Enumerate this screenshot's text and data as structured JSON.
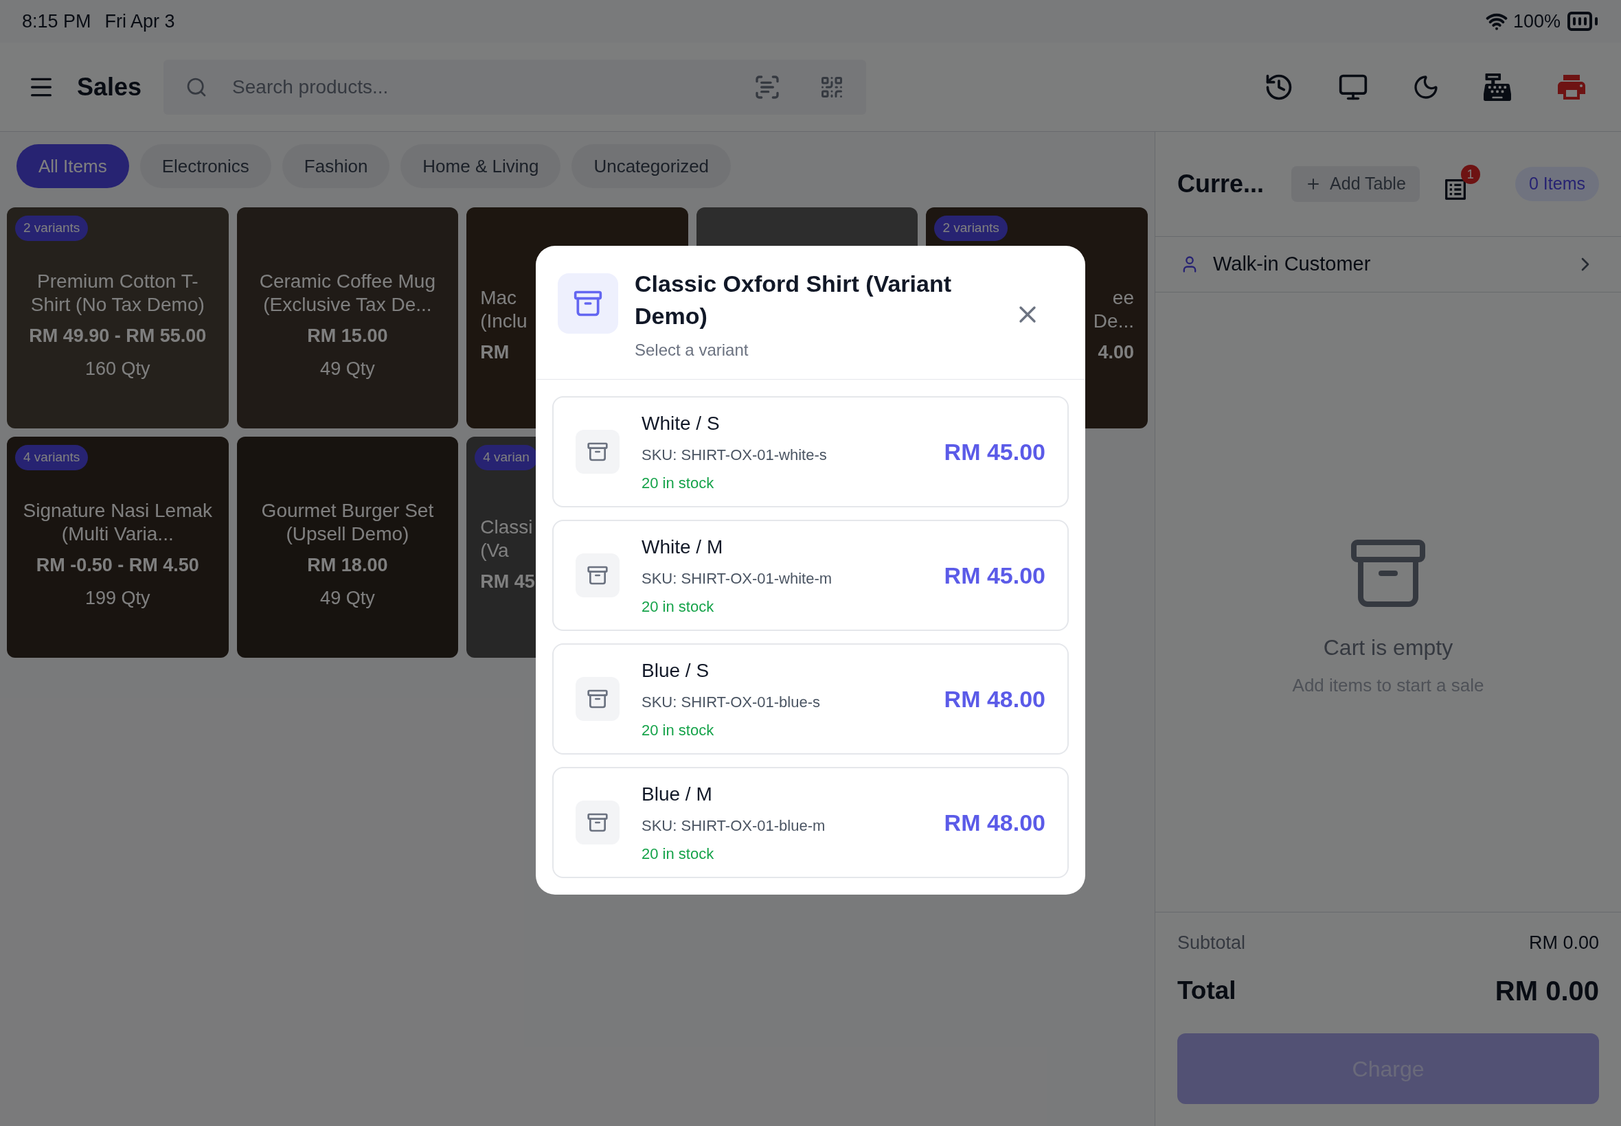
{
  "status_bar": {
    "time": "8:15 PM",
    "date": "Fri Apr 3",
    "battery": "100%"
  },
  "header": {
    "title": "Sales",
    "search": {
      "placeholder": "Search products..."
    }
  },
  "categories": [
    {
      "label": "All Items",
      "selected": true
    },
    {
      "label": "Electronics",
      "selected": false
    },
    {
      "label": "Fashion",
      "selected": false
    },
    {
      "label": "Home & Living",
      "selected": false
    },
    {
      "label": "Uncategorized",
      "selected": false
    }
  ],
  "products": [
    {
      "badge": "2 variants",
      "name": "Premium Cotton T-Shirt (No Tax Demo)",
      "price": "RM 49.90 - RM 55.00",
      "qty": "160 Qty",
      "kind": "full"
    },
    {
      "name": "Ceramic Coffee Mug (Exclusive Tax De...",
      "price": "RM 15.00",
      "qty": "49 Qty",
      "kind": "full"
    },
    {
      "name": "Mac\n(Inclu",
      "price": "RM",
      "kind": "leftcut"
    },
    {
      "kind": "covered"
    },
    {
      "badge": "2 variants",
      "name": "ee\nDe...",
      "price": "4.00",
      "kind": "rightcut"
    },
    {
      "badge": "4 variants",
      "name": "Signature Nasi Lemak (Multi Varia...",
      "price": "RM -0.50 - RM 4.50",
      "qty": "199 Qty",
      "kind": "full"
    },
    {
      "name": "Gourmet Burger Set (Upsell Demo)",
      "price": "RM 18.00",
      "qty": "49 Qty",
      "kind": "full"
    },
    {
      "badge": "4 varian",
      "name": "Classi\n(Va",
      "price": "RM 45",
      "kind": "leftcut"
    }
  ],
  "cart": {
    "title": "Curre...",
    "add_table": "Add Table",
    "orders_badge": "1",
    "items_count": "0 Items",
    "customer": "Walk-in Customer",
    "empty_title": "Cart is empty",
    "empty_subtitle": "Add items to start a sale",
    "subtotal_label": "Subtotal",
    "subtotal": "RM 0.00",
    "total_label": "Total",
    "total": "RM 0.00",
    "charge": "Charge",
    "charge_disabled": true
  },
  "modal": {
    "title": "Classic Oxford Shirt (Variant Demo)",
    "subtitle": "Select a variant",
    "variants": [
      {
        "name": "White / S",
        "sku": "SKU: SHIRT-OX-01-white-s",
        "stock": "20 in stock",
        "price": "RM 45.00"
      },
      {
        "name": "White / M",
        "sku": "SKU: SHIRT-OX-01-white-m",
        "stock": "20 in stock",
        "price": "RM 45.00"
      },
      {
        "name": "Blue / S",
        "sku": "SKU: SHIRT-OX-01-blue-s",
        "stock": "20 in stock",
        "price": "RM 48.00"
      },
      {
        "name": "Blue / M",
        "sku": "SKU: SHIRT-OX-01-blue-m",
        "stock": "20 in stock",
        "price": "RM 48.00"
      }
    ]
  }
}
